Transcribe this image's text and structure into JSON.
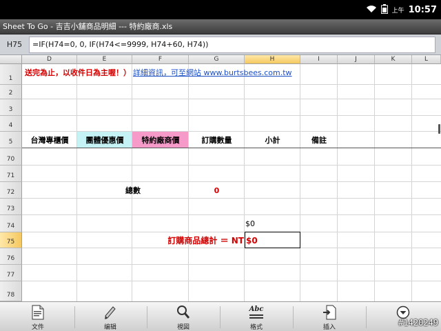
{
  "status_bar": {
    "ampm": "上午",
    "time": "10:57"
  },
  "title_bar": {
    "title": "Sheet To Go - 吉吉小舖商品明細 --- 特約廠商.xls"
  },
  "formula_bar": {
    "cell_ref": "H75",
    "formula": "=IF(H74=0, 0, IF(H74<=9999, H74+60, H74))"
  },
  "columns": [
    "D",
    "E",
    "F",
    "G",
    "H",
    "I",
    "J",
    "K",
    "L"
  ],
  "rows": [
    "1",
    "2",
    "3",
    "4",
    "5",
    "70",
    "71",
    "72",
    "73",
    "74",
    "75",
    "76",
    "77",
    "78"
  ],
  "cells": {
    "notice_red": "送完為止，以收件日為主喔！）",
    "notice_link": "詳細資訊，可至網站 www.burtsbees.com.tw",
    "hdr_tw_price": "台灣專櫃價",
    "hdr_group_price": "團體優惠價",
    "hdr_vendor_price": "特約廠商價",
    "hdr_qty": "訂購數量",
    "hdr_subtotal": "小計",
    "hdr_note": "備註",
    "total_count_label": "總數",
    "total_count_value": "0",
    "sum_value": "$0",
    "grand_total_label": "訂購商品總計 ＝ NT",
    "grand_total_value": "$0"
  },
  "toolbar": {
    "file": "文件",
    "edit": "编辑",
    "view": "視図",
    "format": "格式",
    "format_icon_text": "Abc",
    "insert": "插入"
  },
  "watermark": "#1420249",
  "colors": {
    "red": "#d40000",
    "link": "#1d4fc4",
    "cyan_fill": "#c4f2f5",
    "pink_fill": "#f59ac9",
    "selection": "#f5c860"
  }
}
